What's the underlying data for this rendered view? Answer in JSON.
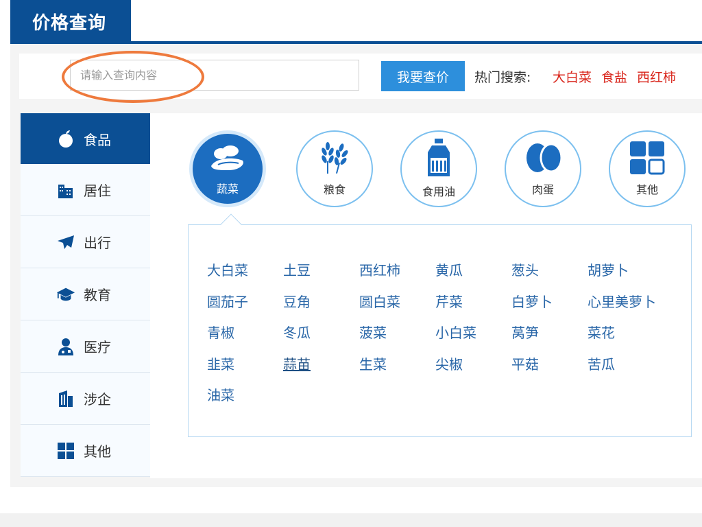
{
  "header": {
    "title": "价格查询"
  },
  "search": {
    "placeholder": "请输入查询内容",
    "button_label": "我要查价",
    "hot_label": "热门搜索:",
    "hot_terms": [
      "大白菜",
      "食盐",
      "西红柿"
    ]
  },
  "sidebar": {
    "items": [
      {
        "label": "食品",
        "icon": "apple-icon"
      },
      {
        "label": "居住",
        "icon": "buildings-icon"
      },
      {
        "label": "出行",
        "icon": "airplane-icon"
      },
      {
        "label": "教育",
        "icon": "graduation-cap-icon"
      },
      {
        "label": "医疗",
        "icon": "doctor-icon"
      },
      {
        "label": "涉企",
        "icon": "office-building-icon"
      },
      {
        "label": "其他",
        "icon": "grid-icon"
      }
    ]
  },
  "categories": [
    {
      "label": "蔬菜",
      "icon": "vegetable-icon"
    },
    {
      "label": "粮食",
      "icon": "wheat-icon"
    },
    {
      "label": "食用油",
      "icon": "oil-bottle-icon"
    },
    {
      "label": "肉蛋",
      "icon": "eggs-icon"
    },
    {
      "label": "其他",
      "icon": "grid-icon"
    }
  ],
  "items": [
    "大白菜",
    "土豆",
    "西红柿",
    "黄瓜",
    "葱头",
    "胡萝卜",
    "圆茄子",
    "豆角",
    "圆白菜",
    "芹菜",
    "白萝卜",
    "心里美萝卜",
    "青椒",
    "冬瓜",
    "菠菜",
    "小白菜",
    "莴笋",
    "菜花",
    "韭菜",
    "蒜苗",
    "生菜",
    "尖椒",
    "平菇",
    "苦瓜",
    "油菜"
  ],
  "colors": {
    "brand": "#0b4f94",
    "accent": "#2d8fdc",
    "hot": "#d9261c",
    "item": "#2a67a8",
    "annotation": "#ee7a3d"
  }
}
